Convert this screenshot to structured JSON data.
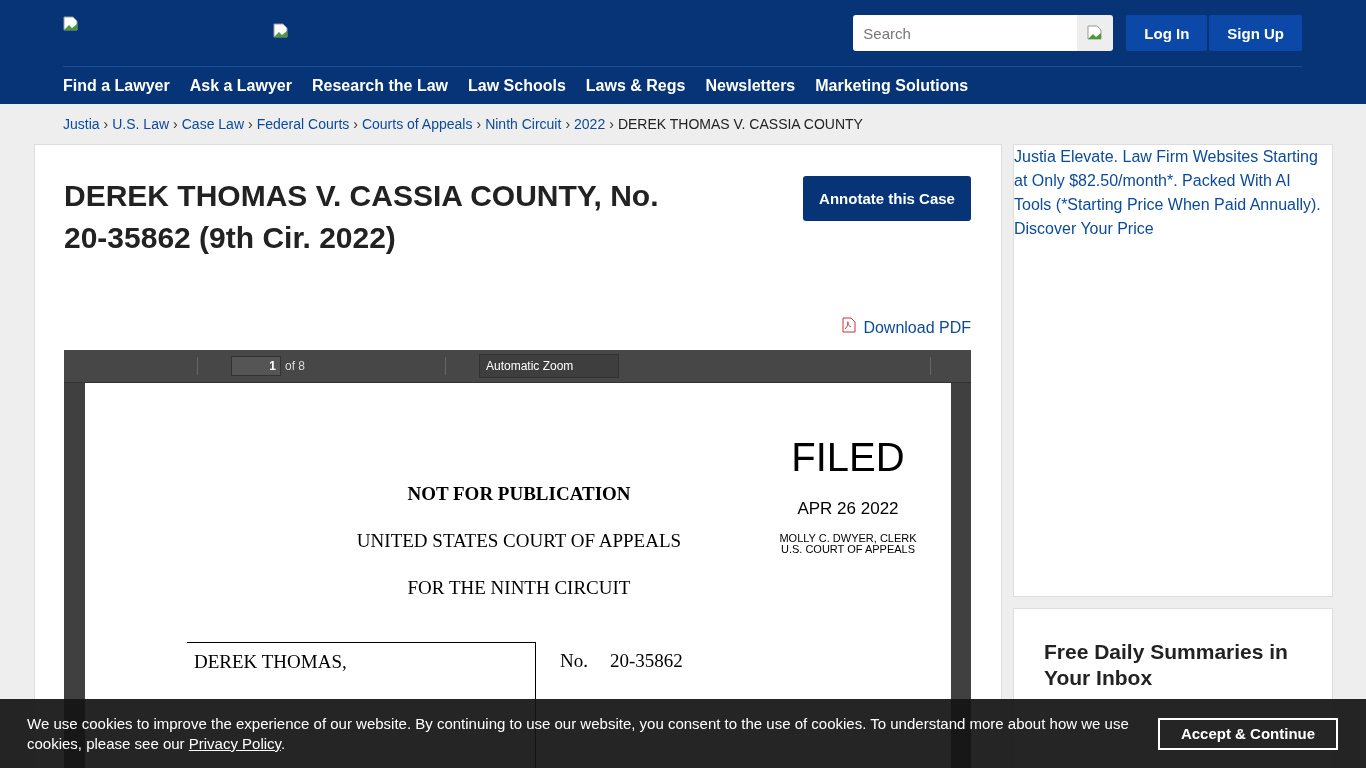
{
  "header": {
    "search": {
      "placeholder": "Search"
    },
    "buttons": [
      {
        "label": "Log In"
      },
      {
        "label": "Sign Up"
      }
    ]
  },
  "nav": [
    "Find a Lawyer",
    "Ask a Lawyer",
    "Research the Law",
    "Law Schools",
    "Laws & Regs",
    "Newsletters",
    "Marketing Solutions"
  ],
  "breadcrumb": {
    "links": [
      "Justia",
      "U.S. Law",
      "Case Law",
      "Federal Courts",
      "Courts of Appeals",
      "Ninth Circuit",
      "2022"
    ],
    "separator": "›",
    "current": "DEREK THOMAS V. CASSIA COUNTY"
  },
  "case": {
    "title": "DEREK THOMAS V. CASSIA COUNTY, No. 20-35862 (9th Cir. 2022)",
    "annotate_button": "Annotate this Case",
    "download": "Download PDF"
  },
  "pdf_viewer": {
    "page_number": "1",
    "page_count": "of 8",
    "zoom": "Automatic Zoom",
    "document": {
      "filed": "FILED",
      "date": "APR 26 2022",
      "clerk": [
        "MOLLY C. DWYER, CLERK",
        "U.S. COURT OF APPEALS"
      ],
      "lines": [
        "NOT FOR PUBLICATION",
        "UNITED STATES COURT OF APPEALS",
        "FOR THE NINTH CIRCUIT"
      ],
      "party": "DEREK THOMAS,",
      "case_label": "No.",
      "case_number": "20-35862"
    }
  },
  "sidebar": {
    "ad_text": "Justia Elevate. Law Firm Websites Starting at Only $82.50/month*. Packed With AI Tools (*Starting Price When Paid Annually). Discover Your Price",
    "newsletter_title": "Free Daily Summaries in Your Inbox"
  },
  "cookie_banner": {
    "text_before": "We use cookies to improve the experience of our website. By continuing to use our website, you consent to the use of cookies. To understand more about how we use cookies, please see our ",
    "link": "Privacy Policy",
    "text_after": ".",
    "button": "Accept & Continue"
  }
}
